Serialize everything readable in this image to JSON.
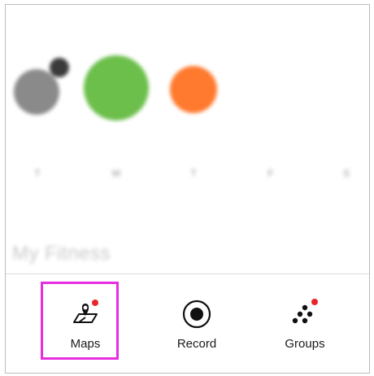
{
  "colors": {
    "accent_highlight": "#e62ee0",
    "notification": "#e8242b",
    "goal_met": "#6cbf4b",
    "partial": "#ff7a2e",
    "past": "#8a8a8a"
  },
  "calendar": {
    "days": [
      {
        "value": "",
        "badge": "",
        "state": "past"
      },
      {
        "value": "",
        "state": "goal_met"
      },
      {
        "value": "",
        "state": "partial"
      },
      {
        "value": "",
        "state": "empty"
      },
      {
        "value": "",
        "state": "empty"
      }
    ],
    "labels": [
      "T",
      "W",
      "T",
      "F",
      "S"
    ]
  },
  "section_title": "My Fitness",
  "tabs": [
    {
      "label": "Maps",
      "icon": "map-pin-icon",
      "selected": true,
      "has_notification": true
    },
    {
      "label": "Record",
      "icon": "record-icon",
      "selected": false,
      "has_notification": false
    },
    {
      "label": "Groups",
      "icon": "groups-icon",
      "selected": false,
      "has_notification": true
    }
  ]
}
